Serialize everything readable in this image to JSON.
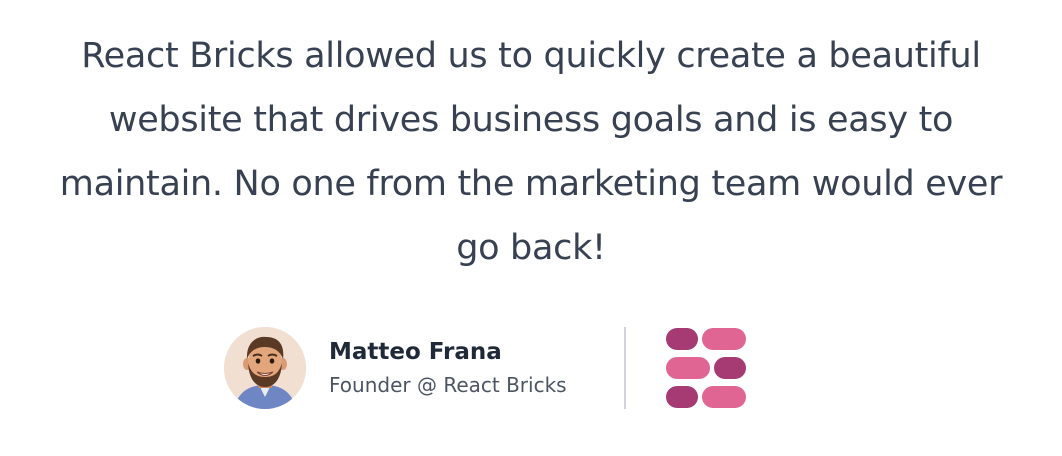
{
  "testimonial": {
    "quote": "React Bricks allowed us to quickly create a beautiful website that drives business goals and is easy to maintain. No one from the marketing team would ever go back!",
    "author": {
      "name": "Matteo Frana",
      "role": "Founder @ React Bricks",
      "avatar_icon": "bearded-man-avatar"
    },
    "company_logo": {
      "icon": "react-bricks-logo-icon",
      "colors": {
        "dark": "#a63a73",
        "light": "#e06593"
      }
    }
  },
  "colors": {
    "quote_text": "#374151",
    "author_name": "#1f2937",
    "author_role": "#4b5563",
    "divider": "#d1d5db",
    "background": "#ffffff"
  }
}
